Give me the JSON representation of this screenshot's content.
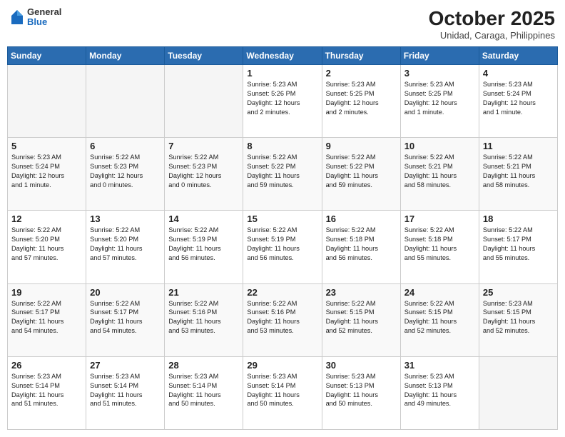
{
  "header": {
    "logo": {
      "general": "General",
      "blue": "Blue"
    },
    "month": "October 2025",
    "location": "Unidad, Caraga, Philippines"
  },
  "weekdays": [
    "Sunday",
    "Monday",
    "Tuesday",
    "Wednesday",
    "Thursday",
    "Friday",
    "Saturday"
  ],
  "weeks": [
    [
      {
        "day": "",
        "info": ""
      },
      {
        "day": "",
        "info": ""
      },
      {
        "day": "",
        "info": ""
      },
      {
        "day": "1",
        "info": "Sunrise: 5:23 AM\nSunset: 5:26 PM\nDaylight: 12 hours\nand 2 minutes."
      },
      {
        "day": "2",
        "info": "Sunrise: 5:23 AM\nSunset: 5:25 PM\nDaylight: 12 hours\nand 2 minutes."
      },
      {
        "day": "3",
        "info": "Sunrise: 5:23 AM\nSunset: 5:25 PM\nDaylight: 12 hours\nand 1 minute."
      },
      {
        "day": "4",
        "info": "Sunrise: 5:23 AM\nSunset: 5:24 PM\nDaylight: 12 hours\nand 1 minute."
      }
    ],
    [
      {
        "day": "5",
        "info": "Sunrise: 5:23 AM\nSunset: 5:24 PM\nDaylight: 12 hours\nand 1 minute."
      },
      {
        "day": "6",
        "info": "Sunrise: 5:22 AM\nSunset: 5:23 PM\nDaylight: 12 hours\nand 0 minutes."
      },
      {
        "day": "7",
        "info": "Sunrise: 5:22 AM\nSunset: 5:23 PM\nDaylight: 12 hours\nand 0 minutes."
      },
      {
        "day": "8",
        "info": "Sunrise: 5:22 AM\nSunset: 5:22 PM\nDaylight: 11 hours\nand 59 minutes."
      },
      {
        "day": "9",
        "info": "Sunrise: 5:22 AM\nSunset: 5:22 PM\nDaylight: 11 hours\nand 59 minutes."
      },
      {
        "day": "10",
        "info": "Sunrise: 5:22 AM\nSunset: 5:21 PM\nDaylight: 11 hours\nand 58 minutes."
      },
      {
        "day": "11",
        "info": "Sunrise: 5:22 AM\nSunset: 5:21 PM\nDaylight: 11 hours\nand 58 minutes."
      }
    ],
    [
      {
        "day": "12",
        "info": "Sunrise: 5:22 AM\nSunset: 5:20 PM\nDaylight: 11 hours\nand 57 minutes."
      },
      {
        "day": "13",
        "info": "Sunrise: 5:22 AM\nSunset: 5:20 PM\nDaylight: 11 hours\nand 57 minutes."
      },
      {
        "day": "14",
        "info": "Sunrise: 5:22 AM\nSunset: 5:19 PM\nDaylight: 11 hours\nand 56 minutes."
      },
      {
        "day": "15",
        "info": "Sunrise: 5:22 AM\nSunset: 5:19 PM\nDaylight: 11 hours\nand 56 minutes."
      },
      {
        "day": "16",
        "info": "Sunrise: 5:22 AM\nSunset: 5:18 PM\nDaylight: 11 hours\nand 56 minutes."
      },
      {
        "day": "17",
        "info": "Sunrise: 5:22 AM\nSunset: 5:18 PM\nDaylight: 11 hours\nand 55 minutes."
      },
      {
        "day": "18",
        "info": "Sunrise: 5:22 AM\nSunset: 5:17 PM\nDaylight: 11 hours\nand 55 minutes."
      }
    ],
    [
      {
        "day": "19",
        "info": "Sunrise: 5:22 AM\nSunset: 5:17 PM\nDaylight: 11 hours\nand 54 minutes."
      },
      {
        "day": "20",
        "info": "Sunrise: 5:22 AM\nSunset: 5:17 PM\nDaylight: 11 hours\nand 54 minutes."
      },
      {
        "day": "21",
        "info": "Sunrise: 5:22 AM\nSunset: 5:16 PM\nDaylight: 11 hours\nand 53 minutes."
      },
      {
        "day": "22",
        "info": "Sunrise: 5:22 AM\nSunset: 5:16 PM\nDaylight: 11 hours\nand 53 minutes."
      },
      {
        "day": "23",
        "info": "Sunrise: 5:22 AM\nSunset: 5:15 PM\nDaylight: 11 hours\nand 52 minutes."
      },
      {
        "day": "24",
        "info": "Sunrise: 5:22 AM\nSunset: 5:15 PM\nDaylight: 11 hours\nand 52 minutes."
      },
      {
        "day": "25",
        "info": "Sunrise: 5:23 AM\nSunset: 5:15 PM\nDaylight: 11 hours\nand 52 minutes."
      }
    ],
    [
      {
        "day": "26",
        "info": "Sunrise: 5:23 AM\nSunset: 5:14 PM\nDaylight: 11 hours\nand 51 minutes."
      },
      {
        "day": "27",
        "info": "Sunrise: 5:23 AM\nSunset: 5:14 PM\nDaylight: 11 hours\nand 51 minutes."
      },
      {
        "day": "28",
        "info": "Sunrise: 5:23 AM\nSunset: 5:14 PM\nDaylight: 11 hours\nand 50 minutes."
      },
      {
        "day": "29",
        "info": "Sunrise: 5:23 AM\nSunset: 5:14 PM\nDaylight: 11 hours\nand 50 minutes."
      },
      {
        "day": "30",
        "info": "Sunrise: 5:23 AM\nSunset: 5:13 PM\nDaylight: 11 hours\nand 50 minutes."
      },
      {
        "day": "31",
        "info": "Sunrise: 5:23 AM\nSunset: 5:13 PM\nDaylight: 11 hours\nand 49 minutes."
      },
      {
        "day": "",
        "info": ""
      }
    ]
  ]
}
